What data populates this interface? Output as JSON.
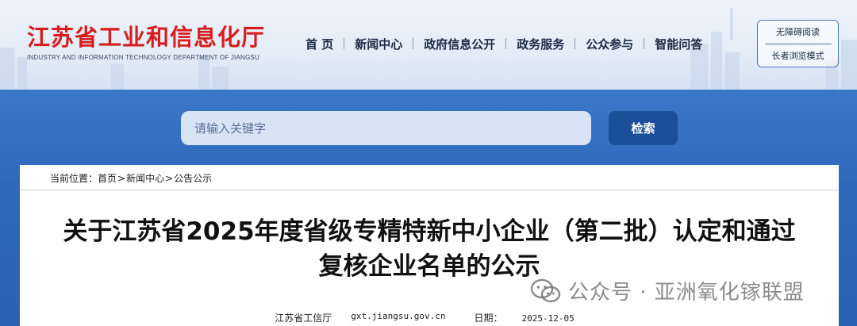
{
  "header": {
    "logo_cn": "江苏省工业和信息化厅",
    "logo_en": "INDUSTRY AND INFORMATION TECHNOLOGY DEPARTMENT OF JIANGSU"
  },
  "nav": {
    "items": [
      {
        "label": "首 页"
      },
      {
        "label": "新闻中心"
      },
      {
        "label": "政府信息公开"
      },
      {
        "label": "政务服务"
      },
      {
        "label": "公众参与"
      },
      {
        "label": "智能问答"
      }
    ]
  },
  "accessibility": {
    "barrier_free": "无障碍阅读",
    "elder_mode": "长者浏览模式"
  },
  "search": {
    "placeholder": "请输入关键字",
    "button_label": "检索"
  },
  "breadcrumb": {
    "prefix": "当前位置：",
    "items": [
      "首页",
      "新闻中心",
      "公告公示"
    ],
    "separator": ">"
  },
  "article": {
    "title_line1": "关于江苏省2025年度省级专精特新中小企业（第二批）认定和通过",
    "title_line2": "复核企业名单的公示",
    "source": "江苏省工信厅",
    "site": "gxt.jiangsu.gov.cn",
    "date_label": "日期：",
    "date": "2025-12-05"
  },
  "watermark": {
    "text": "公众号 · 亚洲氧化镓联盟",
    "icon": "wechat-icon"
  },
  "colors": {
    "logo_red": "#d71e1e",
    "band_blue": "#2d68bb",
    "button_blue": "#1b4f98"
  }
}
